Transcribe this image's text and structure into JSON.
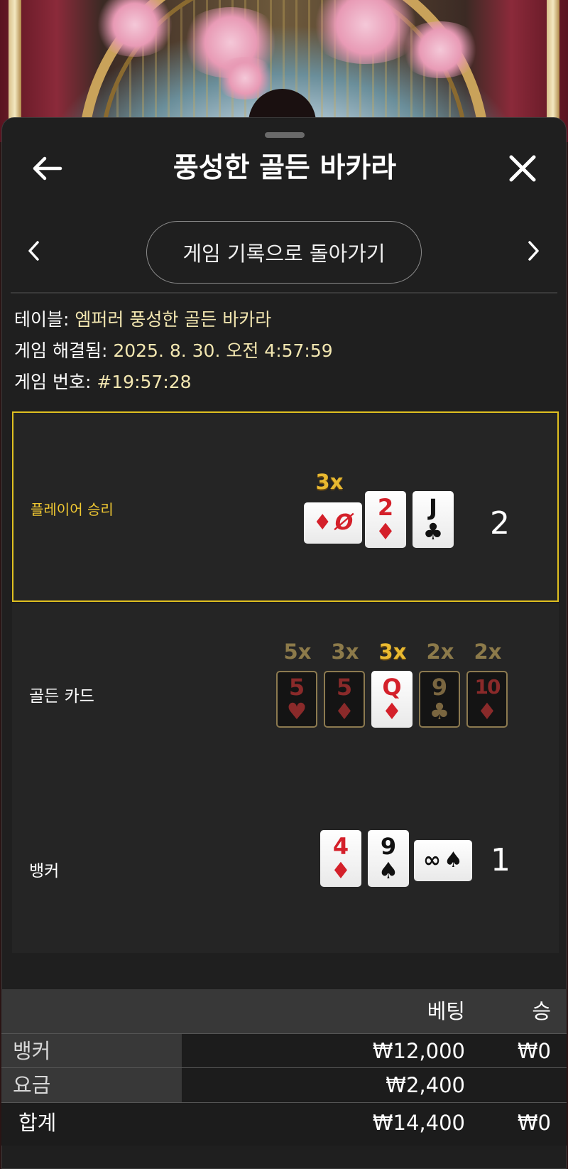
{
  "header": {
    "title": "풍성한 골든 바카라",
    "back_icon": "arrow-left-icon",
    "close_icon": "close-icon"
  },
  "nav": {
    "back_to_history_label": "게임 기록으로 돌아가기",
    "prev_icon": "chevron-left-icon",
    "next_icon": "chevron-right-icon"
  },
  "info": {
    "table_label": "테이블:",
    "table_value": "엠퍼러 풍성한 골든 바카라",
    "resolved_label": "게임 해결됨:",
    "resolved_value": "2025. 8. 30. 오전 4:57:59",
    "number_label": "게임 번호:",
    "number_value": "#19:57:28"
  },
  "player": {
    "label": "플레이어 승리",
    "score": "2",
    "cards": [
      {
        "rank": "Ø",
        "suit": "♦",
        "color": "red",
        "orientation": "side",
        "multiplier": "3x"
      },
      {
        "rank": "2",
        "suit": "♦",
        "color": "red"
      },
      {
        "rank": "J",
        "suit": "♣",
        "color": "black"
      }
    ]
  },
  "golden": {
    "label": "골든 카드",
    "cards": [
      {
        "rank": "5",
        "suit": "♥",
        "color": "red",
        "multiplier": "5x",
        "active": false
      },
      {
        "rank": "5",
        "suit": "♦",
        "color": "red",
        "multiplier": "3x",
        "active": false
      },
      {
        "rank": "Q",
        "suit": "♦",
        "color": "red",
        "multiplier": "3x",
        "active": true
      },
      {
        "rank": "9",
        "suit": "♣",
        "color": "black",
        "multiplier": "2x",
        "active": false
      },
      {
        "rank": "10",
        "suit": "♦",
        "color": "red",
        "multiplier": "2x",
        "active": false
      }
    ]
  },
  "banker": {
    "label": "뱅커",
    "score": "1",
    "cards": [
      {
        "rank": "4",
        "suit": "♦",
        "color": "red"
      },
      {
        "rank": "9",
        "suit": "♠",
        "color": "black"
      },
      {
        "rank": "∞",
        "suit": "♠",
        "color": "black",
        "orientation": "side"
      }
    ]
  },
  "bets": {
    "headers": {
      "bet": "베팅",
      "win": "승"
    },
    "rows": [
      {
        "label": "뱅커",
        "bet": "₩12,000",
        "win": "₩0"
      },
      {
        "label": "요금",
        "bet": "₩2,400",
        "win": ""
      }
    ],
    "total": {
      "label": "합계",
      "bet": "₩14,400",
      "win": "₩0"
    }
  },
  "colors": {
    "accent_gold": "#e0c020",
    "value_text": "#f2e6b0",
    "card_red": "#d4202a"
  }
}
